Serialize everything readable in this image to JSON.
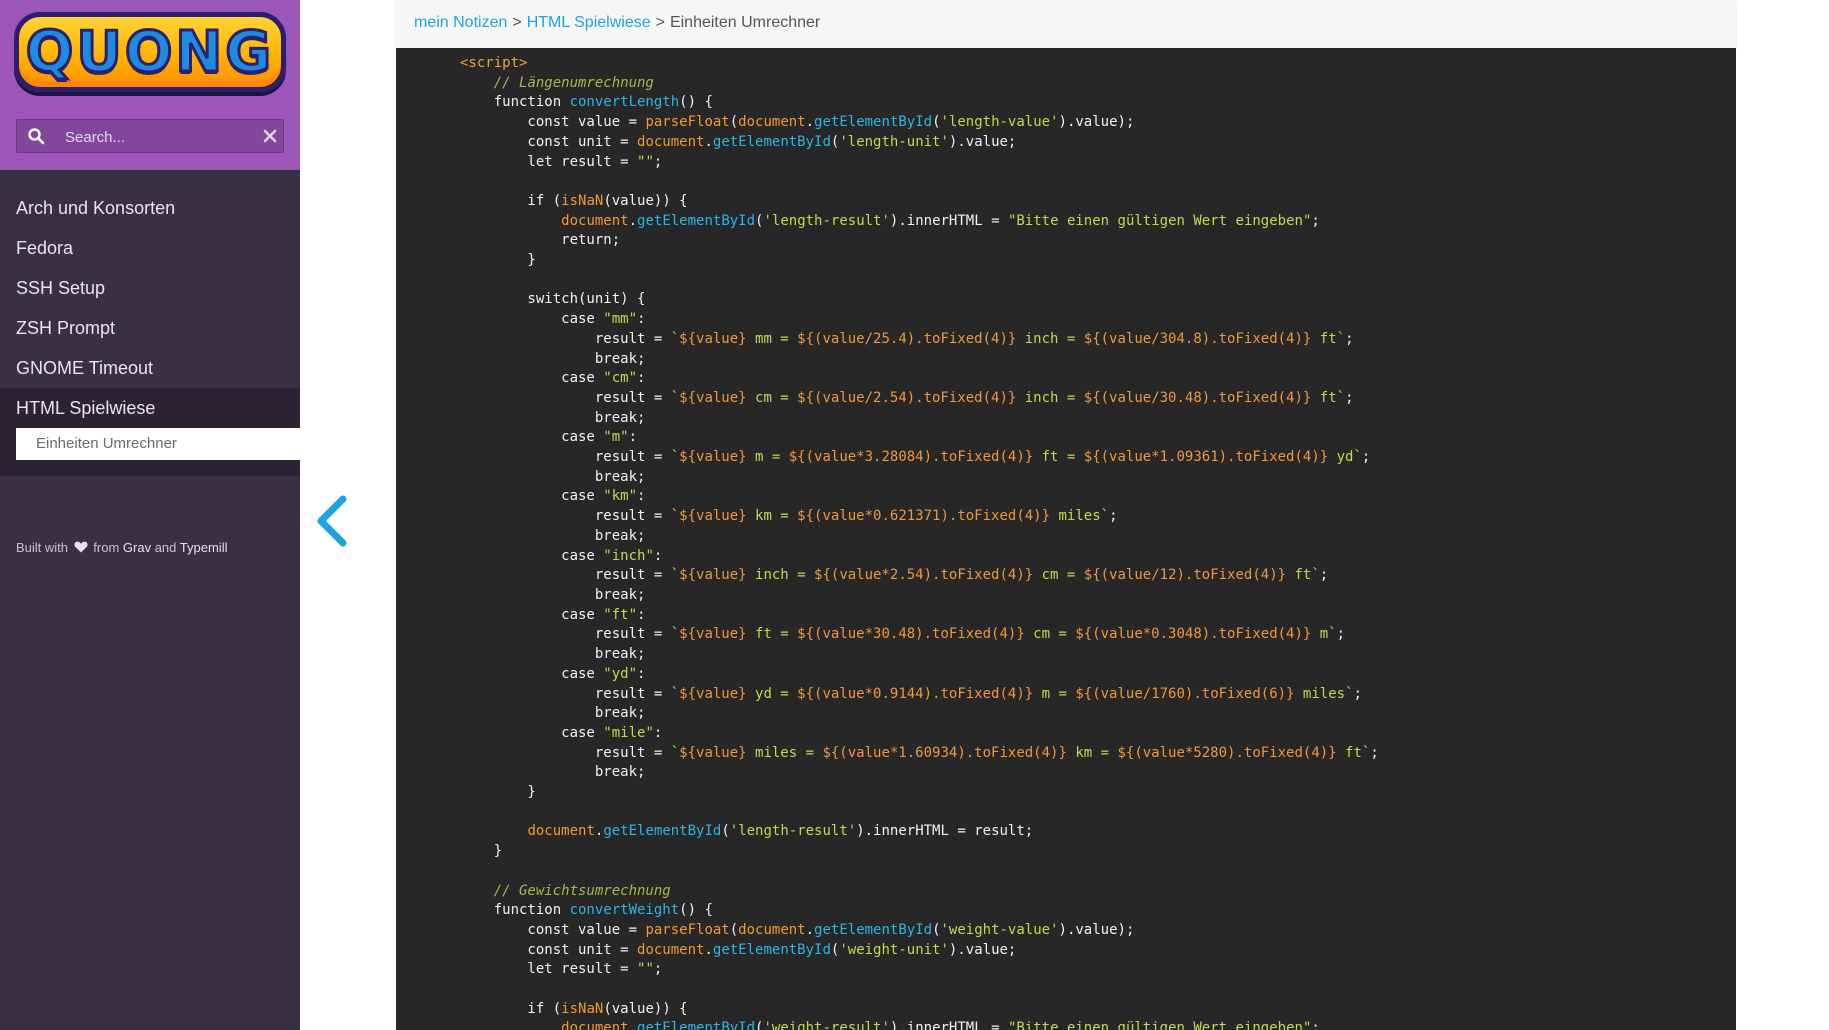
{
  "logo": {
    "text": "QUONG"
  },
  "search": {
    "placeholder": "Search..."
  },
  "nav": {
    "items": [
      {
        "label": "Arch und Konsorten"
      },
      {
        "label": "Fedora"
      },
      {
        "label": "SSH Setup"
      },
      {
        "label": "ZSH Prompt"
      },
      {
        "label": "GNOME Timeout"
      },
      {
        "label": "HTML Spielwiese"
      }
    ],
    "sub_item": "Einheiten Umrechner"
  },
  "footer": {
    "built_with": "Built with",
    "from": "from",
    "grav": "Grav",
    "and": "and",
    "typemill": "Typemill"
  },
  "breadcrumb": {
    "items": [
      "mein Notizen",
      "HTML Spielwiese",
      "Einheiten Umrechner"
    ],
    "separator": ">"
  },
  "code": {
    "language": "javascript",
    "lines": [
      "<script>",
      "    // Längenumrechnung",
      "    function convertLength() {",
      "        const value = parseFloat(document.getElementById('length-value').value);",
      "        const unit = document.getElementById('length-unit').value;",
      "        let result = \"\";",
      "",
      "        if (isNaN(value)) {",
      "            document.getElementById('length-result').innerHTML = \"Bitte einen gültigen Wert eingeben\";",
      "            return;",
      "        }",
      "",
      "        switch(unit) {",
      "            case \"mm\":",
      "                result = `${value} mm = ${(value/25.4).toFixed(4)} inch = ${(value/304.8).toFixed(4)} ft`;",
      "                break;",
      "            case \"cm\":",
      "                result = `${value} cm = ${(value/2.54).toFixed(4)} inch = ${(value/30.48).toFixed(4)} ft`;",
      "                break;",
      "            case \"m\":",
      "                result = `${value} m = ${(value*3.28084).toFixed(4)} ft = ${(value*1.09361).toFixed(4)} yd`;",
      "                break;",
      "            case \"km\":",
      "                result = `${value} km = ${(value*0.621371).toFixed(4)} miles`;",
      "                break;",
      "            case \"inch\":",
      "                result = `${value} inch = ${(value*2.54).toFixed(4)} cm = ${(value/12).toFixed(4)} ft`;",
      "                break;",
      "            case \"ft\":",
      "                result = `${value} ft = ${(value*30.48).toFixed(4)} cm = ${(value*0.3048).toFixed(4)} m`;",
      "                break;",
      "            case \"yd\":",
      "                result = `${value} yd = ${(value*0.9144).toFixed(4)} m = ${(value/1760).toFixed(6)} miles`;",
      "                break;",
      "            case \"mile\":",
      "                result = `${value} miles = ${(value*1.60934).toFixed(4)} km = ${(value*5280).toFixed(4)} ft`;",
      "                break;",
      "        }",
      "",
      "        document.getElementById('length-result').innerHTML = result;",
      "    }",
      "",
      "    // Gewichtsumrechnung",
      "    function convertWeight() {",
      "        const value = parseFloat(document.getElementById('weight-value').value);",
      "        const unit = document.getElementById('weight-unit').value;",
      "        let result = \"\";",
      "",
      "        if (isNaN(value)) {",
      "            document.getElementById('weight-result').innerHTML = \"Bitte einen gültigen Wert eingeben\";"
    ]
  },
  "colors": {
    "sidebar_bg": "#3a3043",
    "sidebar_header_bg": "#9c56b8",
    "code_bg": "#272727",
    "link": "#1fa3e0"
  }
}
